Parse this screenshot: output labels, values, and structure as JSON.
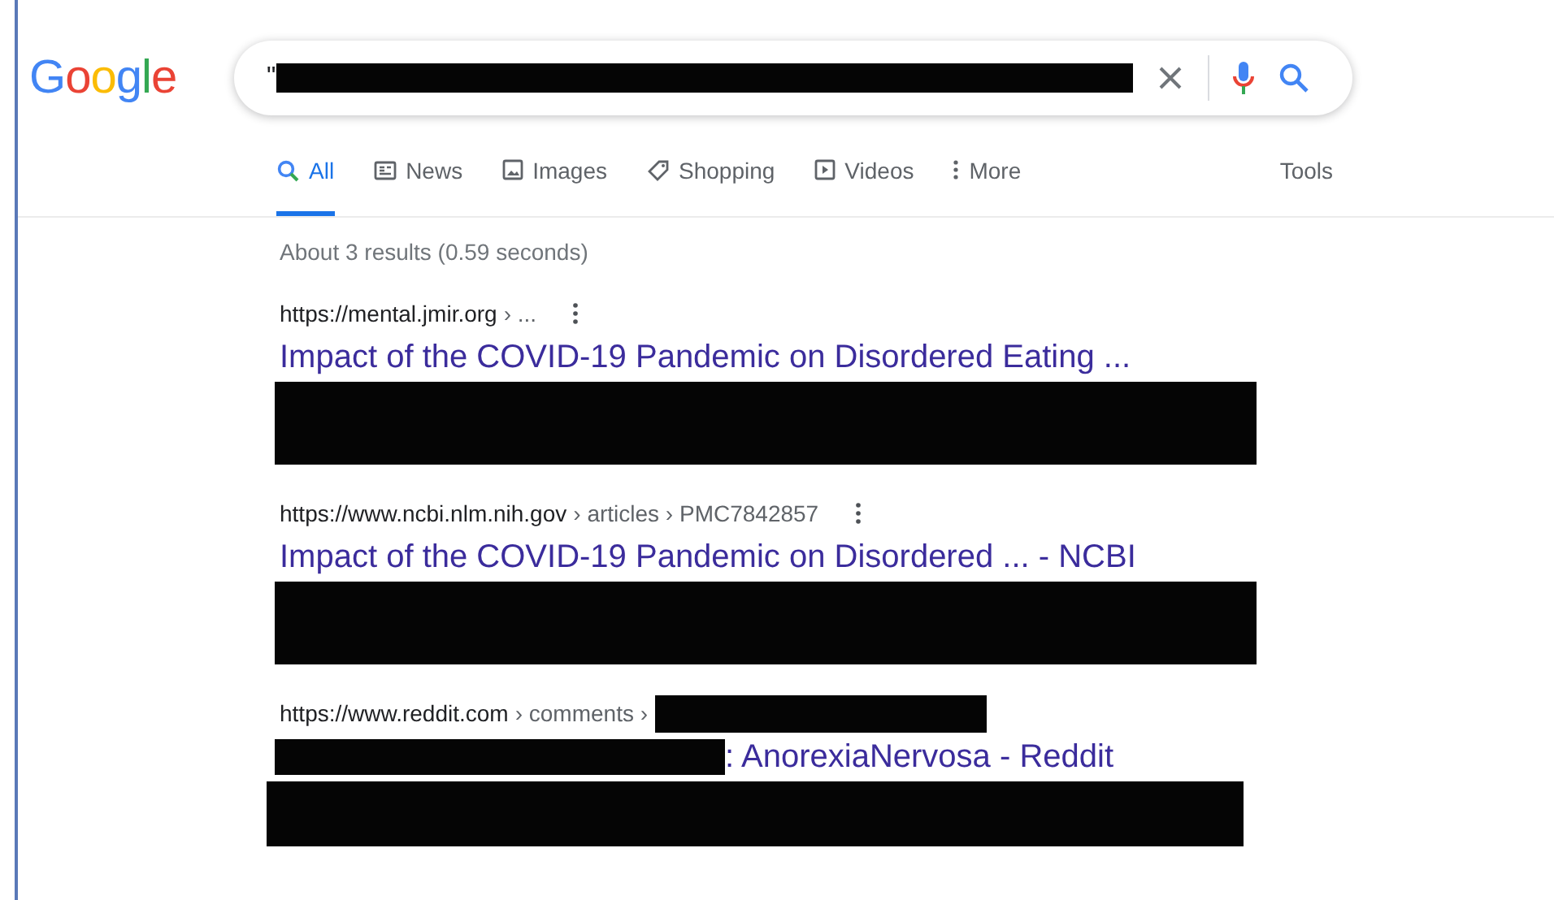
{
  "logo": "Google",
  "search": {
    "value": "\"",
    "redacted": true
  },
  "tabs": [
    {
      "label": "All",
      "kind": "search",
      "selected": true
    },
    {
      "label": "News",
      "kind": "news",
      "selected": false
    },
    {
      "label": "Images",
      "kind": "image",
      "selected": false
    },
    {
      "label": "Shopping",
      "kind": "tag",
      "selected": false
    },
    {
      "label": "Videos",
      "kind": "video",
      "selected": false
    },
    {
      "label": "More",
      "kind": "dots",
      "selected": false
    }
  ],
  "tools": "Tools",
  "stats": "About 3 results (0.59 seconds)",
  "results": [
    {
      "site": "https://mental.jmir.org",
      "path": "› ...",
      "url_redacted": false,
      "title_redacted": false,
      "title": "Impact of the COVID-19 Pandemic on Disordered Eating ...",
      "snippet_redacted": true
    },
    {
      "site": "https://www.ncbi.nlm.nih.gov",
      "path": "› articles › PMC7842857",
      "url_redacted": false,
      "title_redacted": false,
      "title": "Impact of the COVID-19 Pandemic on Disordered ... - NCBI",
      "snippet_redacted": true
    },
    {
      "site": "https://www.reddit.com",
      "path": "› comments ›",
      "url_redacted": true,
      "title_redacted": true,
      "title": ": AnorexiaNervosa - Reddit",
      "snippet_redacted": true
    }
  ]
}
